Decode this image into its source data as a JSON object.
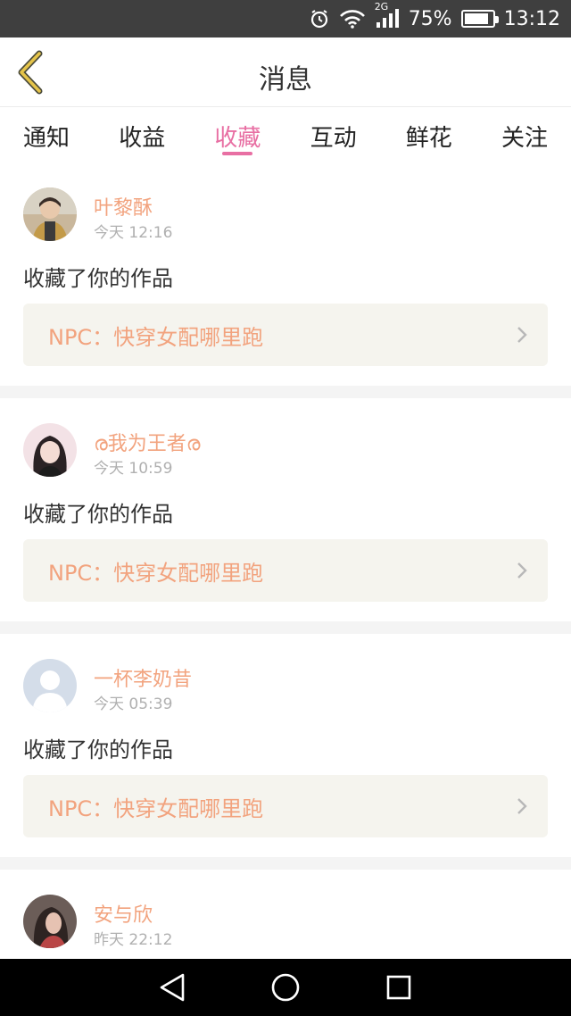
{
  "status_bar": {
    "network": "2G",
    "battery": "75%",
    "battery_level": 0.75,
    "time": "13:12"
  },
  "header": {
    "title": "消息"
  },
  "tabs": [
    {
      "label": "通知"
    },
    {
      "label": "收益"
    },
    {
      "label": "收藏",
      "active": true
    },
    {
      "label": "互动"
    },
    {
      "label": "鲜花"
    },
    {
      "label": "关注"
    }
  ],
  "feed": [
    {
      "user": "叶黎酥",
      "time": "今天 12:16",
      "action": "收藏了你的作品",
      "work": "NPC：快穿女配哪里跑"
    },
    {
      "user": "ര我为王者ര",
      "time": "今天 10:59",
      "action": "收藏了你的作品",
      "work": "NPC：快穿女配哪里跑"
    },
    {
      "user": "一杯李奶昔",
      "time": "今天 05:39",
      "action": "收藏了你的作品",
      "work": "NPC：快穿女配哪里跑"
    },
    {
      "user": "安与欣",
      "time": "昨天 22:12"
    }
  ],
  "colors": {
    "accent": "#e86fa3",
    "name": "#f2a37e",
    "card_bg": "#f5f4ee",
    "back_icon": "#e5c44a"
  },
  "icons": [
    "alarm-icon",
    "wifi-icon",
    "signal-icon",
    "battery-icon",
    "back-chevron-icon",
    "chevron-right-icon",
    "nav-back-icon",
    "nav-home-icon",
    "nav-recents-icon"
  ]
}
